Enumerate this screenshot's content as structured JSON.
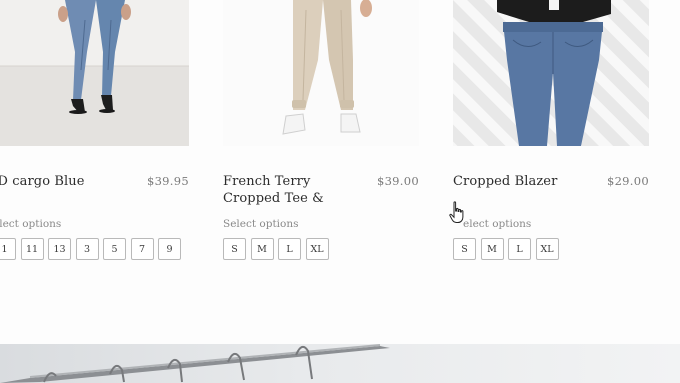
{
  "products": [
    {
      "title": "-D cargo Blue",
      "price": "$39.95",
      "select_label": "elect options",
      "sizes": [
        "1",
        "11",
        "13",
        "3",
        "5",
        "7",
        "9"
      ]
    },
    {
      "title": "French Terry Cropped Tee &",
      "price": "$39.00",
      "select_label": "Select options",
      "sizes": [
        "S",
        "M",
        "L",
        "XL"
      ]
    },
    {
      "title": "Cropped Blazer",
      "price": "$29.00",
      "select_label": "elect options",
      "sizes": [
        "S",
        "M",
        "L",
        "XL"
      ]
    }
  ],
  "colors": {
    "text": "#2b2b2b",
    "price": "#7a7a7a",
    "border": "#b9b9b9",
    "denim": "#5f7fa8",
    "beige": "#d9ccb8"
  }
}
